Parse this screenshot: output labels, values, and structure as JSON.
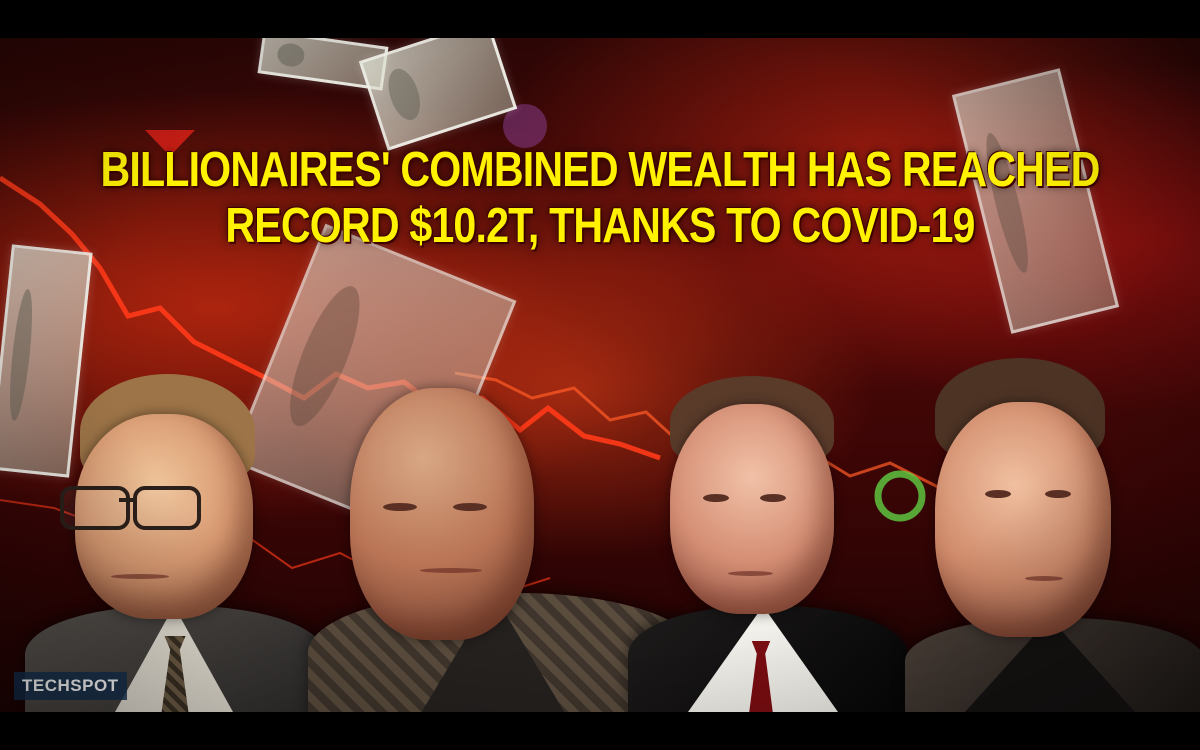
{
  "headline": {
    "line_1": "BILLIONAIRES' COMBINED WEALTH HAS REACHED",
    "line_2": "RECORD $10.2T, THANKS TO COVID-19"
  },
  "watermark": {
    "label": "TECHSPOT"
  },
  "colors": {
    "headline": "#fff200",
    "background_red": "#4a0807",
    "chart_line": "#ff3a18"
  }
}
